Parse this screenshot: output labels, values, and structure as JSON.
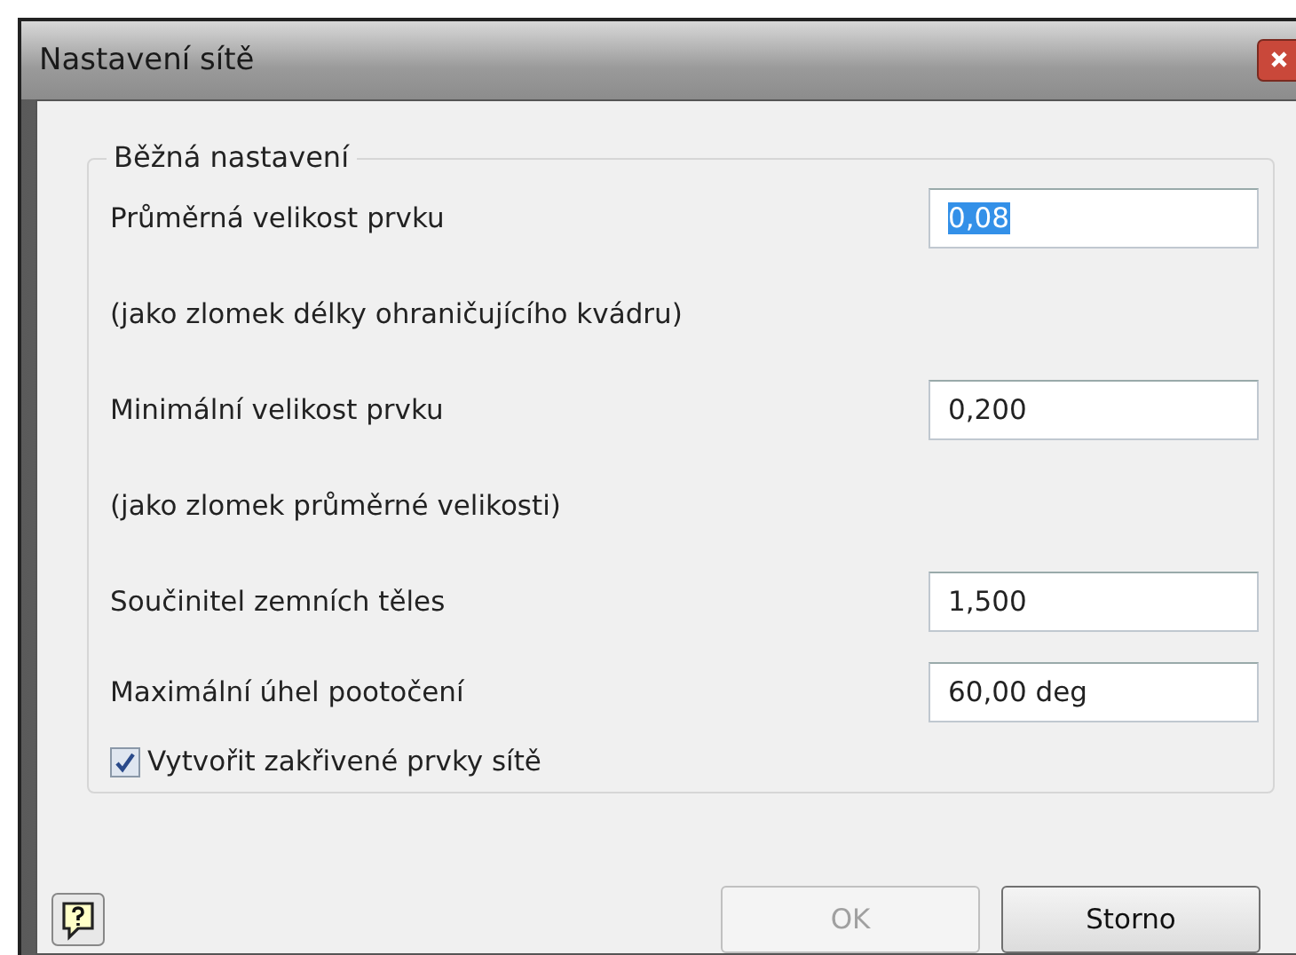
{
  "window": {
    "title": "Nastavení sítě"
  },
  "group": {
    "legend": "Běžná nastavení",
    "rows": [
      {
        "kind": "field",
        "label": "Průměrná velikost prvku",
        "value": "0,08",
        "selected": true
      },
      {
        "kind": "note",
        "label": "(jako zlomek délky ohraničujícího kvádru)"
      },
      {
        "kind": "field",
        "label": "Minimální velikost prvku",
        "value": "0,200",
        "selected": false
      },
      {
        "kind": "note",
        "label": "(jako zlomek průměrné velikosti)"
      },
      {
        "kind": "field",
        "label": "Součinitel zemních těles",
        "value": "1,500",
        "selected": false
      },
      {
        "kind": "field",
        "label": "Maximální úhel pootočení",
        "value": "60,00 deg",
        "selected": false
      },
      {
        "kind": "checkbox",
        "label": "Vytvořit zakřivené prvky sítě",
        "checked": true
      }
    ]
  },
  "buttons": [
    {
      "label": "OK",
      "disabled": true
    },
    {
      "label": "Storno",
      "disabled": false
    }
  ]
}
